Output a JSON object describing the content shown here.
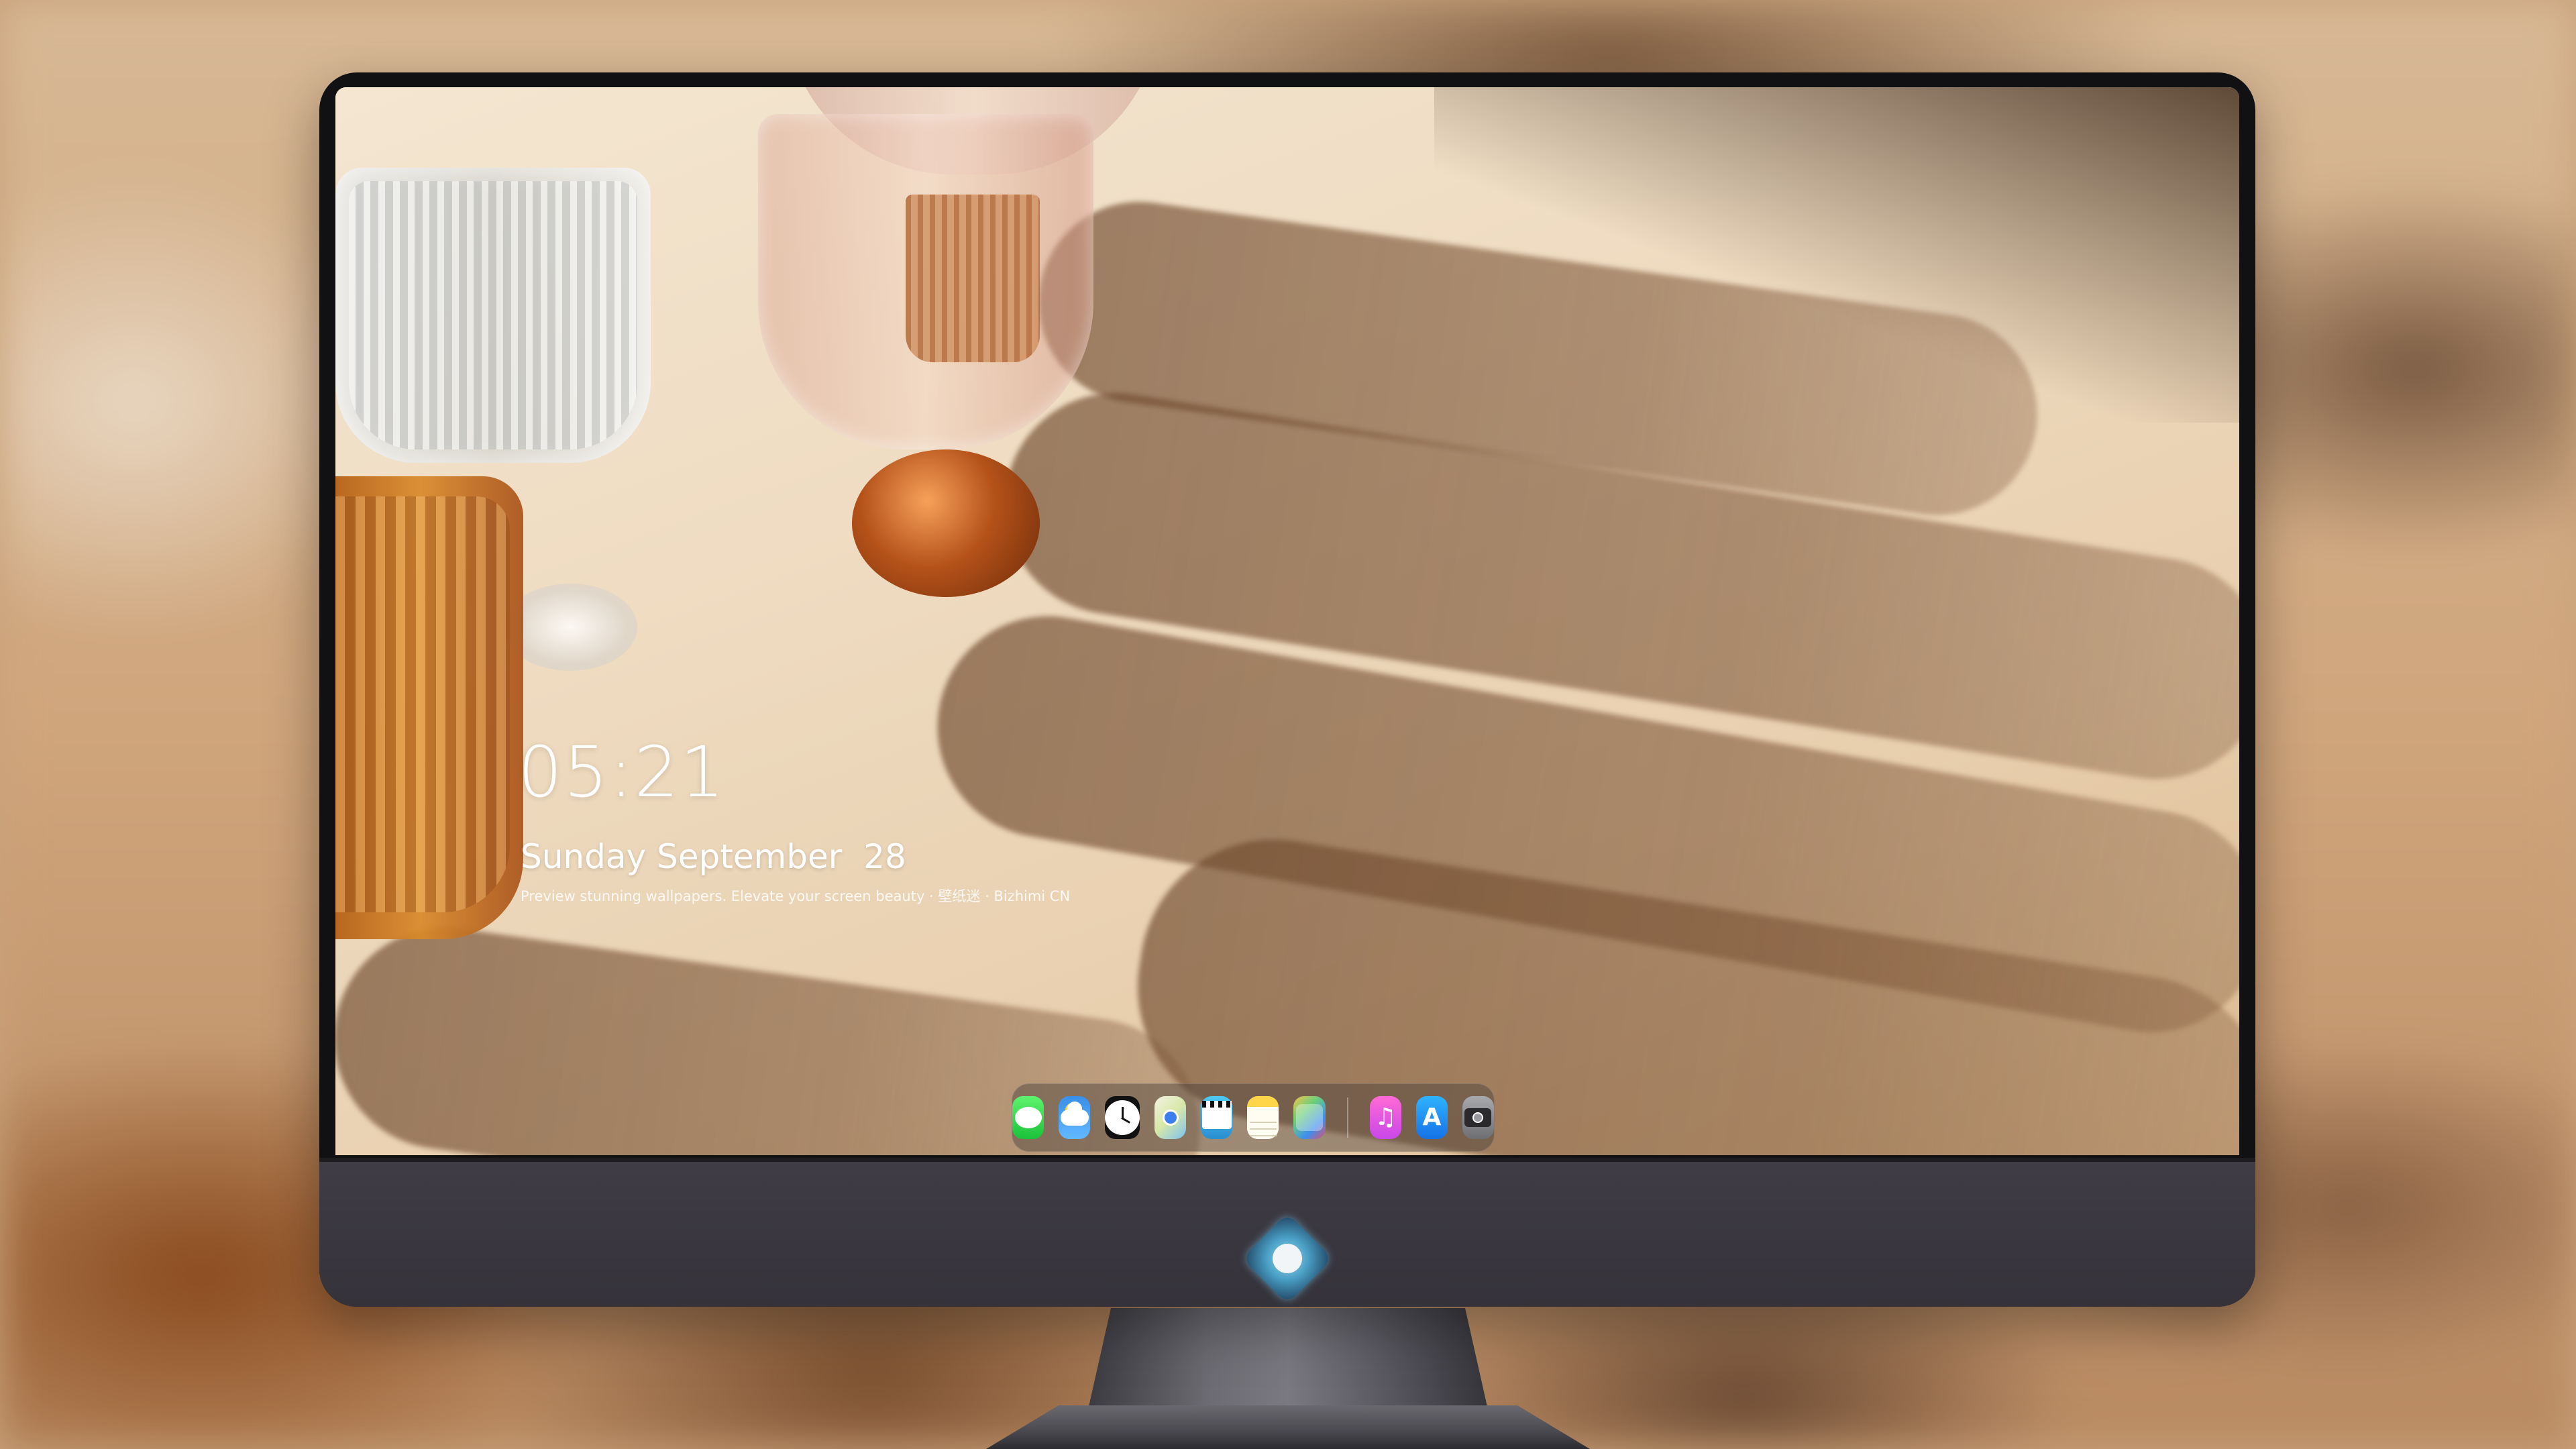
{
  "lock_screen": {
    "time": "05:21",
    "date": "Sunday September  28",
    "caption": "Preview stunning wallpapers. Elevate your screen beauty · 壁纸迷 · Bizhimi CN"
  },
  "dock": {
    "apps": [
      {
        "name": "Messages",
        "icon": "messages-icon"
      },
      {
        "name": "Weather",
        "icon": "weather-icon"
      },
      {
        "name": "Clock",
        "icon": "clock-icon"
      },
      {
        "name": "Maps",
        "icon": "maps-icon"
      },
      {
        "name": "Clips",
        "icon": "video-icon"
      },
      {
        "name": "Notes",
        "icon": "notes-icon"
      },
      {
        "name": "Photo Booth",
        "icon": "photos-icon"
      },
      {
        "name": "Music",
        "icon": "music-icon"
      },
      {
        "name": "App Store",
        "icon": "app-store-icon"
      },
      {
        "name": "Camera",
        "icon": "camera-icon"
      }
    ],
    "music_glyph": "♫",
    "appstore_glyph": "A"
  },
  "colors": {
    "dock_bg": "#463e3a",
    "monitor_bezel": "#111114",
    "monitor_chin": "#3f3c45",
    "clock_text": "#ffffff"
  }
}
